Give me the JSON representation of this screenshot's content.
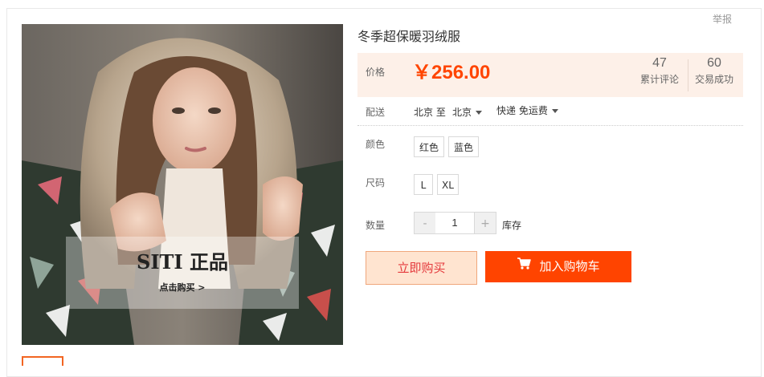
{
  "header": {
    "report_label": "举报"
  },
  "product": {
    "title": "冬季超保暖羽绒服",
    "image_overlay": {
      "brand": "SITI 正品",
      "sub": "点击购买 >"
    }
  },
  "price": {
    "label": "价格",
    "value": "￥256.00",
    "reviews": {
      "count": "47",
      "label": "累计评论"
    },
    "sales": {
      "count": "60",
      "label": "交易成功"
    }
  },
  "shipping": {
    "label": "配送",
    "from": "北京 至",
    "to": "北京",
    "method": "快递 免运费"
  },
  "color": {
    "label": "颜色",
    "options": [
      "红色",
      "蓝色"
    ]
  },
  "size": {
    "label": "尺码",
    "options": [
      "L",
      "XL"
    ]
  },
  "quantity": {
    "label": "数量",
    "minus": "-",
    "value": "1",
    "plus": "+",
    "stock_label": "库存"
  },
  "actions": {
    "buy_now": "立即购买",
    "add_to_cart": "加入购物车"
  },
  "colors": {
    "accent": "#ff4400",
    "price": "#ff4500",
    "price_bg": "#fdf0e8"
  }
}
